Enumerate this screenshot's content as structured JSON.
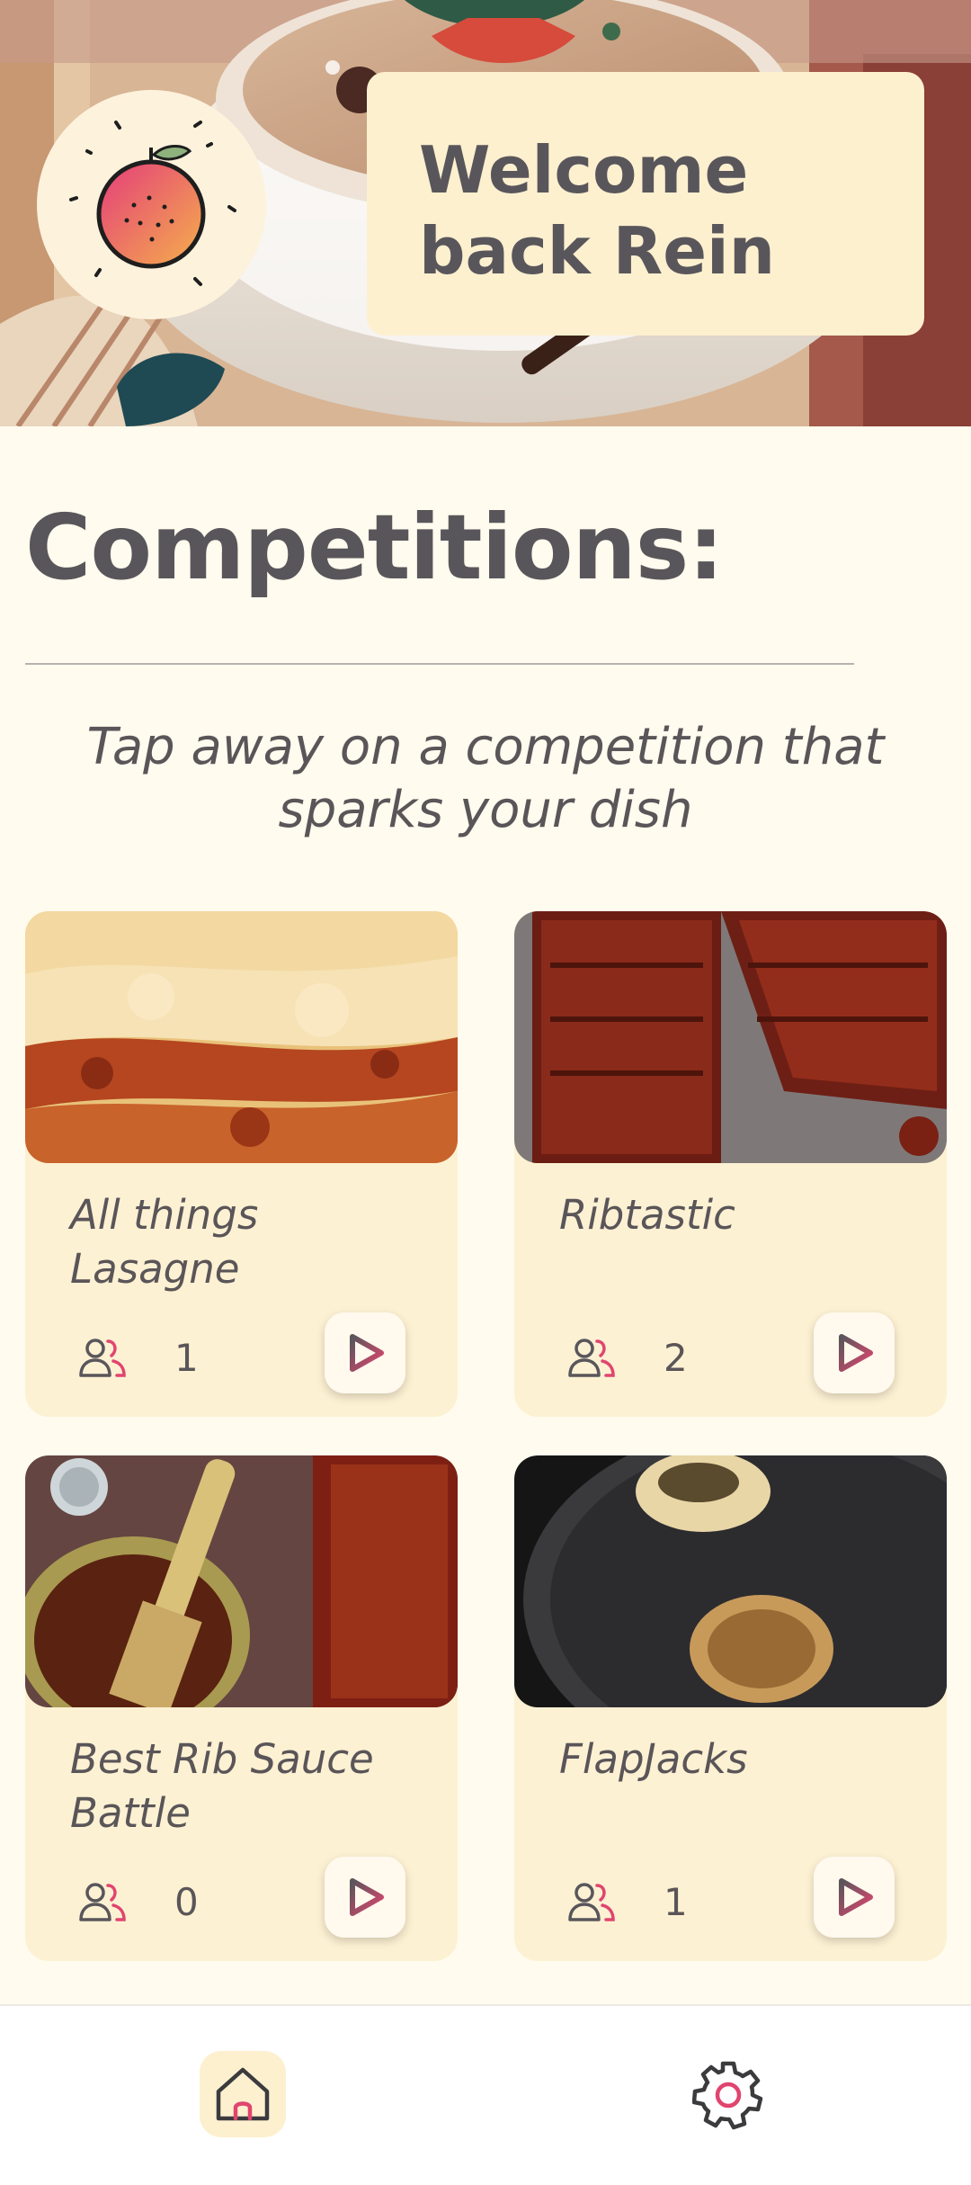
{
  "header": {
    "welcome_text": "Welcome back Rein"
  },
  "main": {
    "title": "Competitions:",
    "subtitle": "Tap away on a competition that sparks your dish"
  },
  "competitions": [
    {
      "name": "All things Lasagne",
      "participants": "1"
    },
    {
      "name": "Ribtastic",
      "participants": "2"
    },
    {
      "name": "Best Rib Sauce Battle",
      "participants": "0"
    },
    {
      "name": "FlapJacks",
      "participants": "1"
    }
  ],
  "icons": {
    "logo": "peach-logo-icon",
    "participants": "people-icon",
    "play": "play-icon",
    "home": "home-icon",
    "settings": "gear-icon"
  },
  "colors": {
    "background": "#fffbee",
    "card": "#fdf1d3",
    "text": "#59565b",
    "accent_pink": "#e0456f",
    "accent_orange": "#f08a4b"
  }
}
